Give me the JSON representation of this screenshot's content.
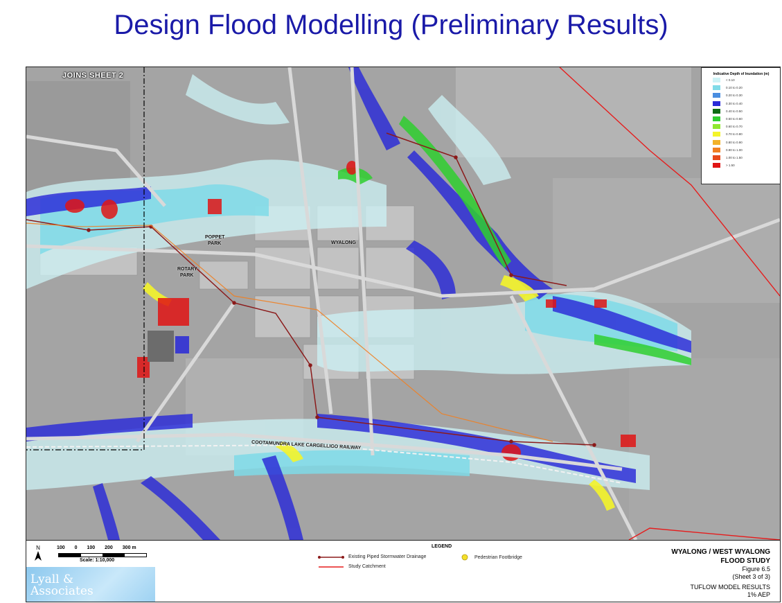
{
  "slide": {
    "title": "Design Flood Modelling (Preliminary Results)"
  },
  "map": {
    "joins_label": "JOINS SHEET 2",
    "labels": {
      "wyalong": "WYALONG",
      "poppet_park_1": "POPPET",
      "poppet_park_2": "PARK",
      "rotary_park_1": "ROTARY",
      "rotary_park_2": "PARK",
      "railway": "COOTAMUNDRA LAKE CARGELLIGO RAILWAY"
    },
    "depth_legend": {
      "title": "Indicative Depth of Inundation (m)",
      "items": [
        {
          "label": "< 0.10",
          "color": "#cdf3f6"
        },
        {
          "label": "0.10 to 0.20",
          "color": "#7fdbe8"
        },
        {
          "label": "0.20 to 0.30",
          "color": "#4a8ee0"
        },
        {
          "label": "0.30 to 0.40",
          "color": "#2a2ad8"
        },
        {
          "label": "0.40 to 0.50",
          "color": "#0e6b14"
        },
        {
          "label": "0.50 to 0.60",
          "color": "#2fcf2f"
        },
        {
          "label": "0.60 to 0.70",
          "color": "#8fe830"
        },
        {
          "label": "0.70 to 0.80",
          "color": "#f4f42a"
        },
        {
          "label": "0.80 to 0.90",
          "color": "#f2b22a"
        },
        {
          "label": "0.90 to 1.00",
          "color": "#f07f22"
        },
        {
          "label": "1.00 to 1.50",
          "color": "#e84a1a"
        },
        {
          "label": "> 1.50",
          "color": "#e01414"
        }
      ]
    }
  },
  "info": {
    "north": "N",
    "scale_ticks": [
      "100",
      "0",
      "100",
      "200",
      "300 m"
    ],
    "scale_caption": "Scale: 1:10,000",
    "logo_line1": "Lyall &",
    "logo_line2": "Associates",
    "legend_heading": "LEGEND",
    "legend_drainage": "Existing Piped Stormwater Drainage",
    "legend_footbridge": "Pedestrian Footbridge",
    "legend_catchment": "Study Catchment",
    "study_title_1": "WYALONG / WEST WYALONG",
    "study_title_2": "FLOOD STUDY",
    "figure_1": "Figure 6.5",
    "figure_2": "(Sheet 3 of 3)",
    "model_1": "TUFLOW MODEL RESULTS",
    "model_2": "1% AEP"
  }
}
